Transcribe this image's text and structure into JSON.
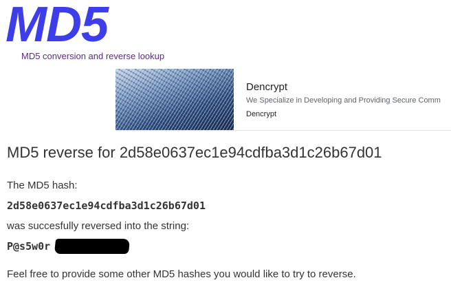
{
  "header": {
    "logo": "MD5",
    "tagline": "MD5 conversion and reverse lookup"
  },
  "ad": {
    "title": "Dencrypt",
    "description": "We Specialize in Developing and Providing Secure Comm",
    "source": "Dencrypt"
  },
  "result": {
    "heading": "MD5 reverse for 2d58e0637ec1e94cdfba3d1c26b67d01",
    "hash_label": "The MD5 hash:",
    "hash_value": "2d58e0637ec1e94cdfba3d1c26b67d01",
    "reversed_label": "was succesfully reversed into the string:",
    "reversed_value": "P@s5w0r",
    "reversed_value_redacted": true,
    "footer_text": "Feel free to provide some other MD5 hashes you would like to try to reverse."
  },
  "colors": {
    "logo": "#3d3dea",
    "tagline": "#5b2a8a",
    "text": "#333333"
  }
}
